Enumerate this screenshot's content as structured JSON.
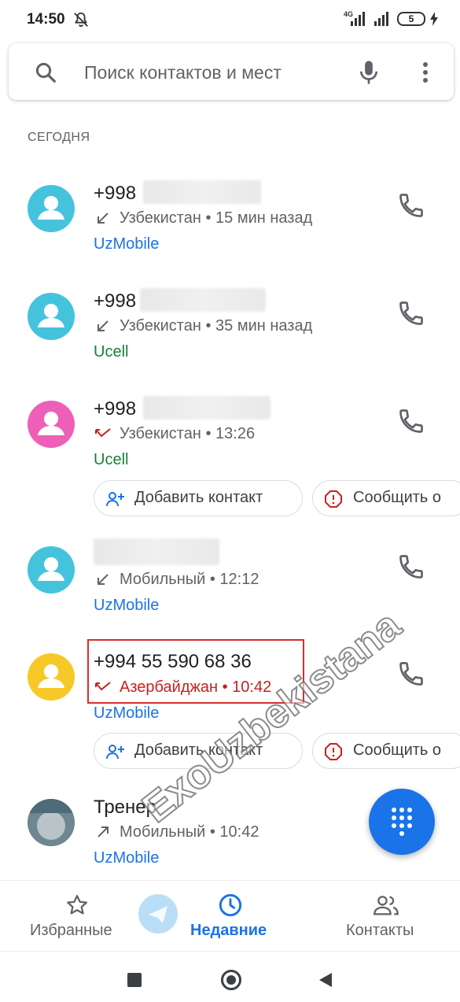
{
  "status": {
    "time": "14:50",
    "network": "4G",
    "battery": "5"
  },
  "search": {
    "placeholder": "Поиск контактов и мест"
  },
  "section": {
    "title": "СЕГОДНЯ"
  },
  "calls": [
    {
      "number": "+998",
      "detail": "Узбекистан • 15 мин назад",
      "carrier": "UzMobile",
      "avatar_color": "#45c3dd",
      "direction": "incoming"
    },
    {
      "number": "+998",
      "detail": "Узбекистан • 35 мин назад",
      "carrier": "Ucell",
      "avatar_color": "#45c3dd",
      "direction": "incoming"
    },
    {
      "number": "+998",
      "detail": "Узбекистан • 13:26",
      "carrier": "Ucell",
      "avatar_color": "#ee5fb8",
      "direction": "missed"
    },
    {
      "number": "",
      "detail": "Мобильный • 12:12",
      "carrier": "UzMobile",
      "avatar_color": "#45c3dd",
      "direction": "incoming"
    },
    {
      "number": "+994 55 590 68 36",
      "detail": "Азербайджан • 10:42",
      "carrier": "UzMobile",
      "avatar_color": "#f6c928",
      "direction": "missed"
    },
    {
      "number": "Тренер",
      "detail": "Мобильный • 10:42",
      "carrier": "UzMobile",
      "avatar_color": "#8a9aa0",
      "direction": "outgoing"
    }
  ],
  "chips": {
    "add_contact": "Добавить контакт",
    "report": "Сообщить о"
  },
  "nav": {
    "favorites": "Избранные",
    "recents": "Недавние",
    "contacts": "Контакты"
  },
  "watermark": "ExoUzbekistana",
  "colors": {
    "accent": "#1a73e8",
    "missed": "#c5221f",
    "ucell": "#188038"
  }
}
